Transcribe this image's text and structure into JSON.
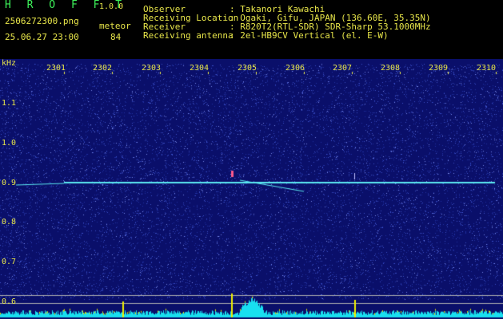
{
  "header": {
    "brand": "H R O F F T",
    "version": "1.0.0",
    "filename": "2506272300.png",
    "meteor_label": "meteor",
    "datetime": "25.06.27 23:00",
    "meteor_count": "84",
    "info": [
      {
        "label": "Observer",
        "value": ": Takanori Kawachi"
      },
      {
        "label": "Receiving Location",
        "value": ": Ogaki, Gifu, JAPAN (136.60E, 35.35N)"
      },
      {
        "label": "Receiver",
        "value": ": R820T2(RTL-SDR) SDR-Sharp 53.1000MHz"
      },
      {
        "label": "Receiving antenna",
        "value": ": 2el-HB9CV Vertical (el. E-W)"
      }
    ]
  },
  "plot": {
    "unit_label": "kHz",
    "x_ticks": [
      "2301",
      "2302",
      "2303",
      "2304",
      "2305",
      "2306",
      "2307",
      "2308",
      "2309",
      "2310"
    ],
    "y_ticks": [
      "1.1",
      "1.0",
      "0.9",
      "0.8",
      "0.7",
      "0.6"
    ],
    "colors": {
      "background": "#0a0f6a",
      "noise": "#3c50c8",
      "carrier": "#5ae8f0",
      "peak": "#ff5a8c",
      "spectrum": "#f0f000",
      "bar": "#18e0f0",
      "text": "#e8e64a"
    }
  }
}
